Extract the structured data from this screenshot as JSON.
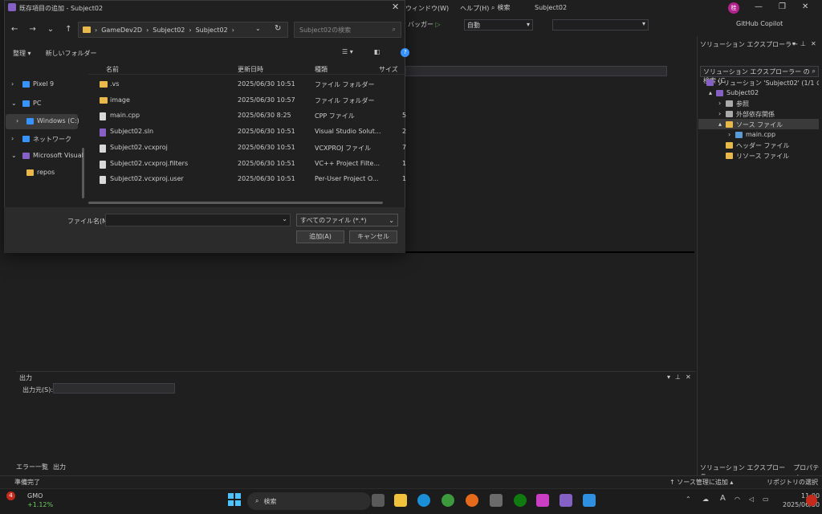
{
  "vs": {
    "menu": [
      "ウィンドウ(W)",
      "ヘルプ(H)"
    ],
    "search_label": "検索",
    "solution_name": "Subject02",
    "avatar": "桂",
    "debugger": "バッガー",
    "config": "自動",
    "copilot": "GitHub Copilot",
    "editor_nav_text": ""
  },
  "dialog": {
    "title": "既存項目の追加 - Subject02",
    "breadcrumb": [
      "GameDev2D",
      "Subject02",
      "Subject02"
    ],
    "search_placeholder": "Subject02の検索",
    "organize": "整理",
    "new_folder": "新しいフォルダー",
    "sidebar": [
      "Pixel 9",
      "PC",
      "Windows (C:)",
      "ネットワーク",
      "Microsoft Visual",
      "repos"
    ],
    "columns": {
      "name": "名前",
      "date": "更新日時",
      "type": "種類",
      "size": "サイズ"
    },
    "files": [
      {
        "name": ".vs",
        "date": "2025/06/30 10:51",
        "type": "ファイル フォルダー",
        "size": "",
        "icon": "folder-icon"
      },
      {
        "name": "image",
        "date": "2025/06/30 10:57",
        "type": "ファイル フォルダー",
        "size": "",
        "icon": "folder-icon"
      },
      {
        "name": "main.cpp",
        "date": "2025/06/30 8:25",
        "type": "CPP ファイル",
        "size": "5",
        "icon": "cpp-file-icon"
      },
      {
        "name": "Subject02.sln",
        "date": "2025/06/30 10:51",
        "type": "Visual Studio Solut...",
        "size": "2",
        "icon": "sln-file-icon"
      },
      {
        "name": "Subject02.vcxproj",
        "date": "2025/06/30 10:51",
        "type": "VCXPROJ ファイル",
        "size": "7",
        "icon": "vcxproj-file-icon"
      },
      {
        "name": "Subject02.vcxproj.filters",
        "date": "2025/06/30 10:51",
        "type": "VC++ Project Filte...",
        "size": "1",
        "icon": "filters-file-icon"
      },
      {
        "name": "Subject02.vcxproj.user",
        "date": "2025/06/30 10:51",
        "type": "Per-User Project O...",
        "size": "1",
        "icon": "user-file-icon"
      }
    ],
    "filename_label": "ファイル名(N):",
    "filename_value": "",
    "filetype": "すべてのファイル (*.*)",
    "add_button": "追加(A)",
    "cancel_button": "キャンセル"
  },
  "output": {
    "title": "出力",
    "source_label": "出力元(S):",
    "tabs": [
      "エラー一覧",
      "出力"
    ]
  },
  "solution_explorer": {
    "title": "ソリューション エクスプローラー",
    "search_placeholder": "ソリューション エクスプローラー の検索 (C",
    "tree": [
      {
        "label": "ソリューション 'Subject02' (1/1 のプロジェ",
        "indent": 0
      },
      {
        "label": "Subject02",
        "indent": 1
      },
      {
        "label": "参照",
        "indent": 2
      },
      {
        "label": "外部依存関係",
        "indent": 2
      },
      {
        "label": "ソース ファイル",
        "indent": 2
      },
      {
        "label": "main.cpp",
        "indent": 3
      },
      {
        "label": "ヘッダー ファイル",
        "indent": 2
      },
      {
        "label": "リソース ファイル",
        "indent": 2
      }
    ],
    "tabs": [
      "ソリューション エクスプローラー",
      "プロパティ"
    ]
  },
  "status": {
    "ready": "準備完了",
    "source_control": "ソース管理に追加",
    "repo": "リポジトリの選択"
  },
  "taskbar": {
    "stock_name": "GMO",
    "stock_change": "+1.12%",
    "stock_badge": "4",
    "search": "検索",
    "ime": "A",
    "time": "11:00",
    "date": "2025/06/30"
  },
  "colors": {
    "accent": "#3794ff",
    "vs_purple": "#8661c5",
    "folder": "#e8b84a"
  }
}
